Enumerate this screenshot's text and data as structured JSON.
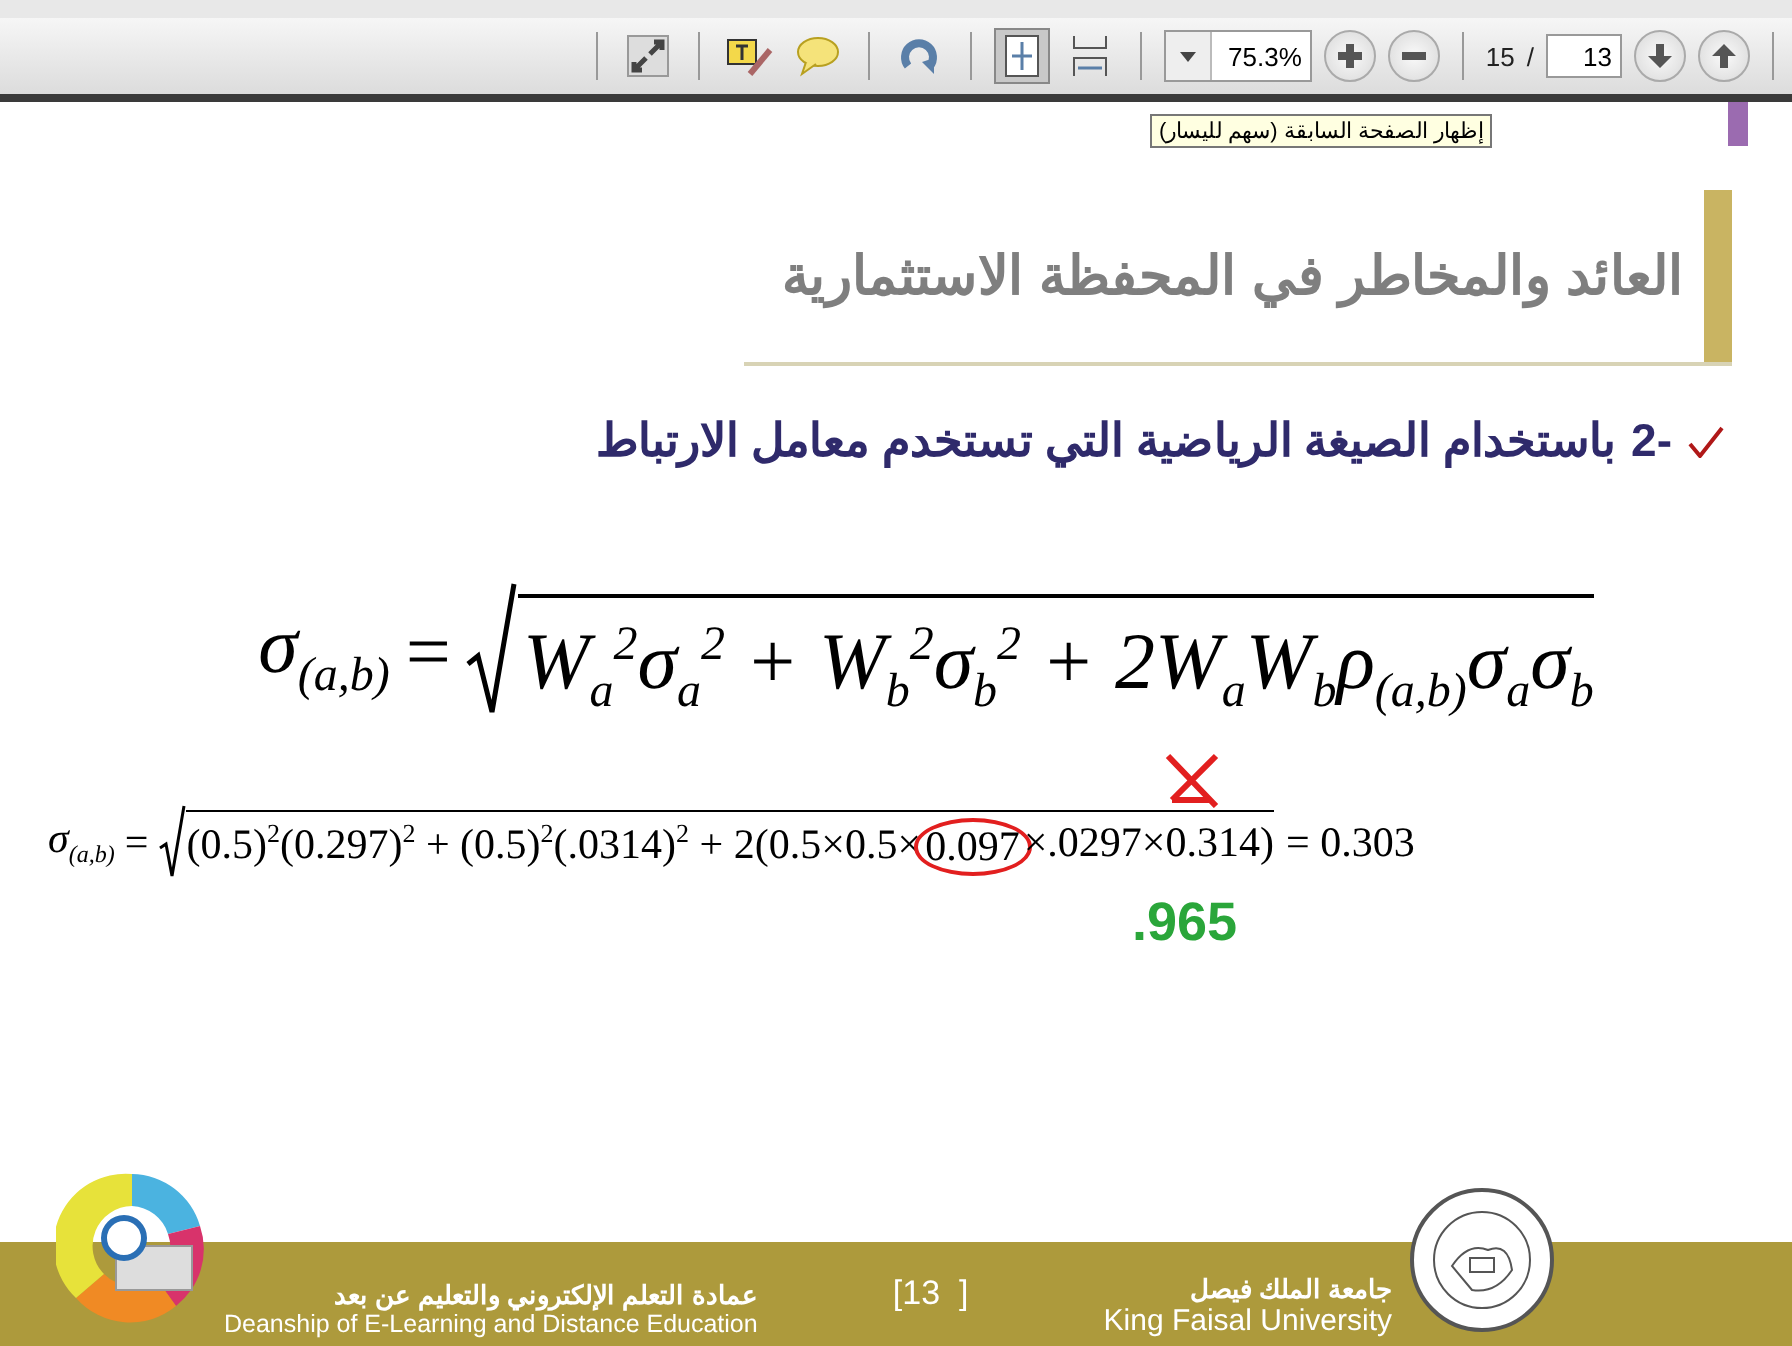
{
  "toolbar": {
    "groups": [
      [
        {
          "kind": "fullscreen",
          "selected": false
        }
      ],
      [
        {
          "kind": "note",
          "selected": false
        },
        {
          "kind": "comment",
          "selected": false
        }
      ],
      [
        {
          "kind": "rotate",
          "selected": false
        }
      ],
      [
        {
          "kind": "fit-page",
          "selected": true
        },
        {
          "kind": "fit-width",
          "selected": false
        }
      ]
    ],
    "zoom_value": "75.3%",
    "page_total": "15",
    "page_separator": "/",
    "page_value": "13",
    "tooltip": "إظهار الصفحة السابقة (سهم لليسار)"
  },
  "slide": {
    "title": "العائد والمخاطر في المحفظة الاستثمارية",
    "bullet": {
      "number": "2-",
      "text": "باستخدام الصيغة الرياضية التي تستخدم معامل الارتباط"
    },
    "formula_1": {
      "lhs": "σ$_{(a,b)}$",
      "equals": "=",
      "radicand": "W$_{a}$$^{2}$σ$_{a}$$^{2}$ + W$_{b}$$^{2}$σ$_{b}$$^{2}$ + 2W$_{a}$W$_{b}$ρ$_{(a,b)}$σ$_{a}$σ$_{b}$"
    },
    "formula_2": {
      "lhs": "σ$_{(a,b)}$",
      "equals": "=",
      "radicand_before": "(0.5)$^{2}$(0.297)$^{2}$ + (0.5)$^{2}$(.0314)$^{2}$ + 2(0.5×0.5×",
      "circled": "0.097",
      "radicand_after": "×.0297×0.314)",
      "result": "= 0.303"
    },
    "correction": ".965",
    "footer": {
      "dept_ar": "عمادة التعلم الإلكتروني والتعليم عن بعد",
      "dept_en": "Deanship of E-Learning and Distance Education",
      "page": "[13  ]",
      "uni_ar": "جامعة الملك فيصل",
      "uni_en": "King Faisal University"
    }
  }
}
